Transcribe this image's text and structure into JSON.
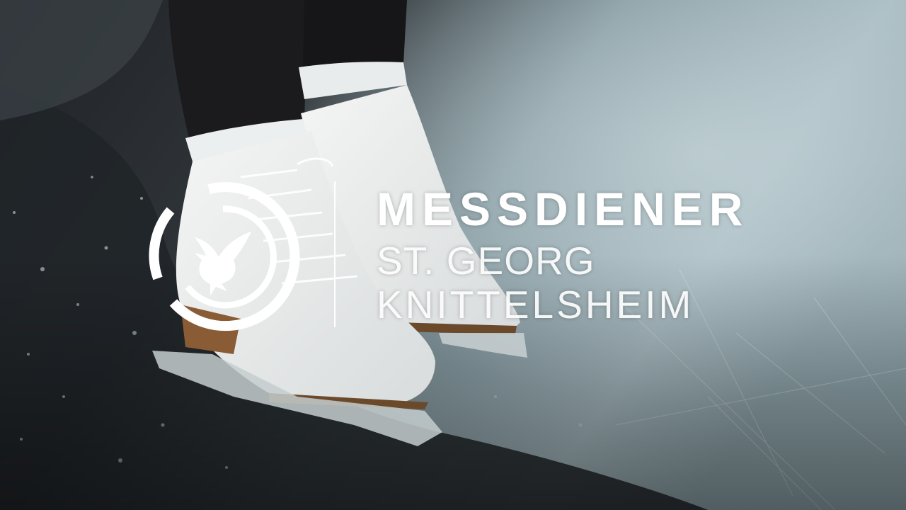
{
  "brand": {
    "title": "MESSDIENER",
    "subtitle_line1": "ST. GEORG",
    "subtitle_line2": "KNITTELSHEIM"
  },
  "logo": {
    "icon": "dove-in-circle-icon",
    "color": "#ffffff"
  },
  "photo": {
    "subject": "white-ice-skates-on-ice",
    "palette": {
      "ice_light": "#a9bcc2",
      "ice_dark": "#22262a",
      "skate": "#eef0ef",
      "leggings": "#1b1a1c",
      "heel": "#8a5c35"
    }
  }
}
